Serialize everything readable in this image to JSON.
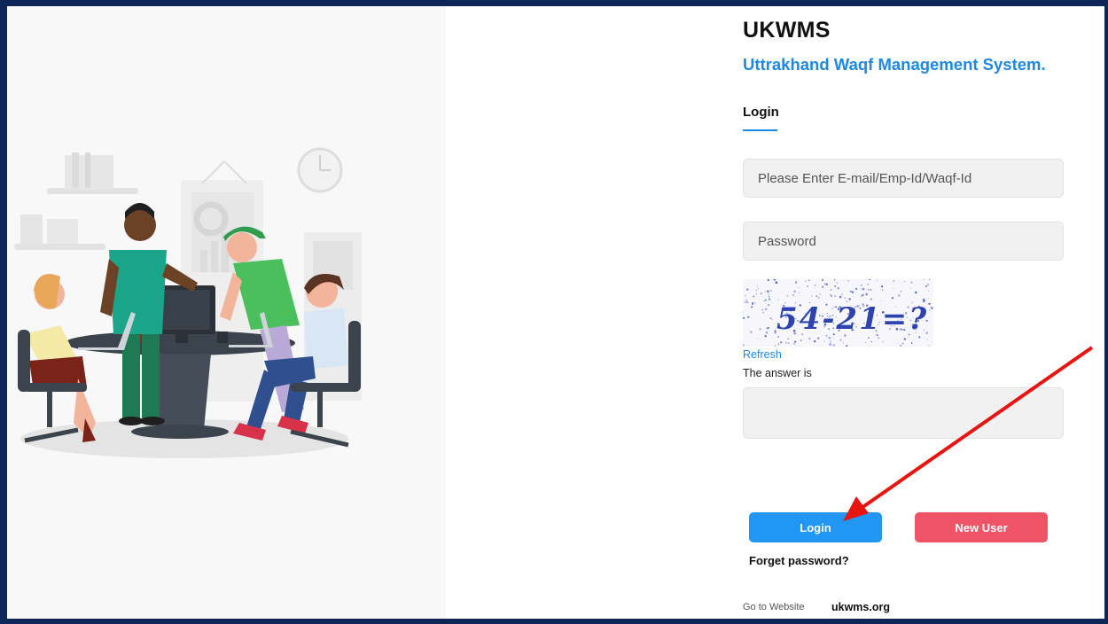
{
  "brand": {
    "title": "UKWMS",
    "subtitle": "Uttrakhand Waqf Management System."
  },
  "tabs": {
    "login_label": "Login"
  },
  "form": {
    "email_placeholder": "Please Enter E-mail/Emp-Id/Waqf-Id",
    "email_value": "",
    "password_placeholder": "Password",
    "password_value": "",
    "captcha_text": "54-21=?",
    "refresh_label": "Refresh",
    "answer_label": "The answer is",
    "answer_value": ""
  },
  "buttons": {
    "login_label": "Login",
    "new_user_label": "New User"
  },
  "links": {
    "forget_password": "Forget password?",
    "go_to_website": "Go to Website",
    "website": "ukwms.org"
  },
  "colors": {
    "frame": "#0d2557",
    "accent": "#1e88e5",
    "login_button": "#2196f3",
    "new_user_button": "#ef5366",
    "annotation_arrow": "#e8140f"
  },
  "icons": {
    "illustration": "team-working-illustration",
    "annotation": "red-arrow-pointer"
  }
}
